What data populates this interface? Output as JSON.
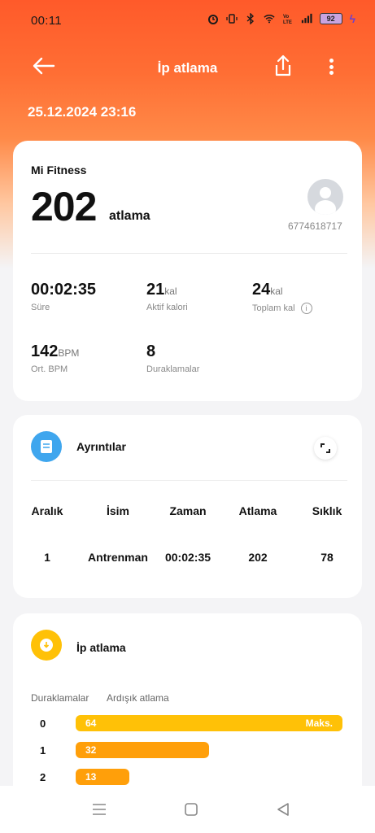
{
  "status": {
    "time": "00:11",
    "battery": "92",
    "icons": [
      "alarm-icon",
      "vibrate-icon",
      "bluetooth-icon",
      "wifi-icon",
      "volte-icon",
      "signal-icon",
      "battery-icon",
      "charging-icon"
    ]
  },
  "appbar": {
    "title": "İp atlama",
    "icons": [
      "back-arrow-icon",
      "share-icon",
      "more-vert-icon"
    ]
  },
  "session": {
    "date": "25.12.2024 23:16"
  },
  "summary": {
    "source": "Mi Fitness",
    "jumps": "202",
    "jumps_unit": "atlama",
    "user_id": "6774618717",
    "metrics": [
      {
        "value": "00:02:35",
        "unit": "",
        "label": "Süre"
      },
      {
        "value": "21",
        "unit": "kal",
        "label": "Aktif kalori"
      },
      {
        "value": "24",
        "unit": "kal",
        "label": "Toplam kal"
      },
      {
        "value": "142",
        "unit": "BPM",
        "label": "Ort. BPM"
      },
      {
        "value": "8",
        "unit": "",
        "label": "Duraklamalar"
      }
    ]
  },
  "details": {
    "title": "Ayrıntılar",
    "columns": [
      "Aralık",
      "İsim",
      "Zaman",
      "Atlama",
      "Sıklık"
    ],
    "rows": [
      [
        "1",
        "Antrenman",
        "00:02:35",
        "202",
        "78"
      ]
    ]
  },
  "jumprope": {
    "title": "İp atlama",
    "legend_left": "Duraklamalar",
    "legend_right": "Ardışık atlama",
    "max_label": "Maks.",
    "rows": [
      {
        "index": "0",
        "value": "64",
        "fraction": 1.0,
        "color": "#ffc107"
      },
      {
        "index": "1",
        "value": "32",
        "fraction": 0.5,
        "color": "#ff9f0a"
      },
      {
        "index": "2",
        "value": "13",
        "fraction": 0.2,
        "color": "#ff9f0a"
      }
    ]
  },
  "colors": {
    "accent": "#ff5a2a",
    "blue_icon": "#3fa6ee",
    "yellow_icon": "#ffc107"
  }
}
